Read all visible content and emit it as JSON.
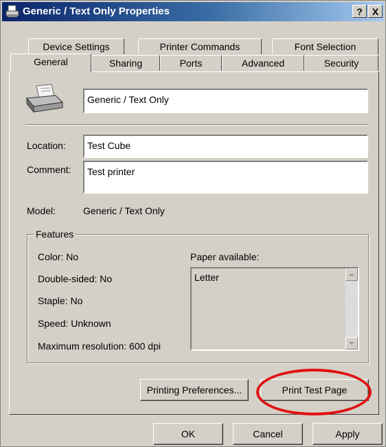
{
  "window": {
    "title": "Generic / Text Only Properties",
    "help_label": "?",
    "close_label": "X"
  },
  "tabs_back": [
    {
      "label": "Device Settings"
    },
    {
      "label": "Printer Commands"
    },
    {
      "label": "Font Selection"
    }
  ],
  "tabs_front": [
    {
      "label": "General"
    },
    {
      "label": "Sharing"
    },
    {
      "label": "Ports"
    },
    {
      "label": "Advanced"
    },
    {
      "label": "Security"
    }
  ],
  "general": {
    "printer_name": "Generic / Text Only",
    "location_label": "Location:",
    "location_value": "Test Cube",
    "comment_label": "Comment:",
    "comment_value": "Test printer",
    "model_label": "Model:",
    "model_value": "Generic / Text Only"
  },
  "features": {
    "title": "Features",
    "color": "Color: No",
    "double_sided": "Double-sided: No",
    "staple": "Staple: No",
    "speed": "Speed: Unknown",
    "max_resolution": "Maximum resolution: 600 dpi",
    "paper_label": "Paper available:",
    "paper_items": [
      "Letter"
    ]
  },
  "buttons": {
    "printing_preferences": "Printing Preferences...",
    "print_test_page": "Print Test Page",
    "ok": "OK",
    "cancel": "Cancel",
    "apply": "Apply"
  },
  "colors": {
    "titlebar_start": "#0a246a",
    "titlebar_end": "#a6caf0",
    "dialog_face": "#d4d0c8",
    "highlight_circle": "#e01010"
  }
}
